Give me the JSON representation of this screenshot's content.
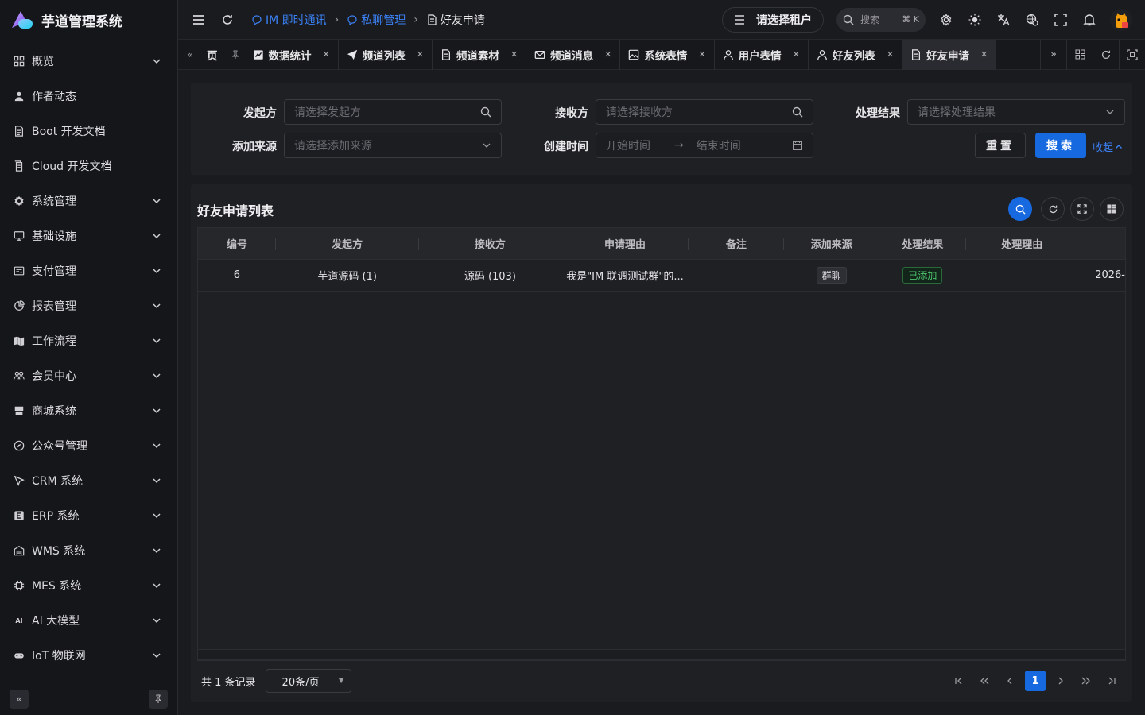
{
  "app": {
    "title": "芋道管理系统",
    "brand_colors": {
      "primary": "#1769e0",
      "logo_purple": "#a78bfa",
      "logo_blue": "#60a5fa"
    }
  },
  "sidebar": {
    "items": [
      {
        "label": "概览",
        "icon": "dashboard-icon",
        "expandable": true
      },
      {
        "label": "作者动态",
        "icon": "user-icon",
        "expandable": false
      },
      {
        "label": "Boot 开发文档",
        "icon": "document-icon",
        "expandable": false
      },
      {
        "label": "Cloud 开发文档",
        "icon": "documents-icon",
        "expandable": false
      },
      {
        "label": "系统管理",
        "icon": "gear-icon",
        "expandable": true
      },
      {
        "label": "基础设施",
        "icon": "monitor-icon",
        "expandable": true
      },
      {
        "label": "支付管理",
        "icon": "payment-icon",
        "expandable": true
      },
      {
        "label": "报表管理",
        "icon": "pie-chart-icon",
        "expandable": true
      },
      {
        "label": "工作流程",
        "icon": "workflow-icon",
        "expandable": true
      },
      {
        "label": "会员中心",
        "icon": "members-icon",
        "expandable": true
      },
      {
        "label": "商城系统",
        "icon": "shop-icon",
        "expandable": true
      },
      {
        "label": "公众号管理",
        "icon": "compass-icon",
        "expandable": true
      },
      {
        "label": "CRM 系统",
        "icon": "crm-icon",
        "expandable": true
      },
      {
        "label": "ERP 系统",
        "icon": "erp-icon",
        "expandable": true
      },
      {
        "label": "WMS 系统",
        "icon": "warehouse-icon",
        "expandable": true
      },
      {
        "label": "MES 系统",
        "icon": "chip-icon",
        "expandable": true
      },
      {
        "label": "AI 大模型",
        "icon": "ai-icon",
        "expandable": true
      },
      {
        "label": "IoT 物联网",
        "icon": "iot-icon",
        "expandable": true
      }
    ]
  },
  "header": {
    "breadcrumbs": [
      {
        "label": "IM 即时通讯",
        "icon": "chat-icon"
      },
      {
        "label": "私聊管理",
        "icon": "chat-icon"
      },
      {
        "label": "好友申请",
        "icon": "document-icon"
      }
    ],
    "tenant_placeholder": "请选择租户",
    "search_label": "搜索",
    "search_shortcut": "⌘ K"
  },
  "tabs": {
    "first_partial": "页",
    "items": [
      {
        "label": "数据统计",
        "icon": "chart-icon",
        "active": false
      },
      {
        "label": "频道列表",
        "icon": "send-icon",
        "active": false
      },
      {
        "label": "频道素材",
        "icon": "document-icon",
        "active": false
      },
      {
        "label": "频道消息",
        "icon": "mail-icon",
        "active": false
      },
      {
        "label": "系统表情",
        "icon": "image-icon",
        "active": false
      },
      {
        "label": "用户表情",
        "icon": "user-icon",
        "active": false
      },
      {
        "label": "好友列表",
        "icon": "user-icon",
        "active": false
      },
      {
        "label": "好友申请",
        "icon": "document-icon",
        "active": true
      }
    ]
  },
  "filters": {
    "initiator": {
      "label": "发起方",
      "placeholder": "请选择发起方"
    },
    "receiver": {
      "label": "接收方",
      "placeholder": "请选择接收方"
    },
    "result": {
      "label": "处理结果",
      "placeholder": "请选择处理结果"
    },
    "source": {
      "label": "添加来源",
      "placeholder": "请选择添加来源"
    },
    "created": {
      "label": "创建时间",
      "start_placeholder": "开始时间",
      "end_placeholder": "结束时间"
    },
    "reset_label": "重置",
    "search_label": "搜索",
    "collapse_label": "收起"
  },
  "list": {
    "title": "好友申请列表",
    "columns": [
      "编号",
      "发起方",
      "接收方",
      "申请理由",
      "备注",
      "添加来源",
      "处理结果",
      "处理理由",
      ""
    ],
    "rows": [
      {
        "id": "6",
        "initiator": "芋道源码 (1)",
        "receiver": "源码 (103)",
        "reason": "我是\"IM 联调测试群\"的...",
        "remark": "",
        "source": "群聊",
        "result": "已添加",
        "result_reason": "",
        "created": "2026-"
      }
    ],
    "total_text": "共 1 条记录",
    "page_size": "20条/页",
    "current_page": "1"
  }
}
